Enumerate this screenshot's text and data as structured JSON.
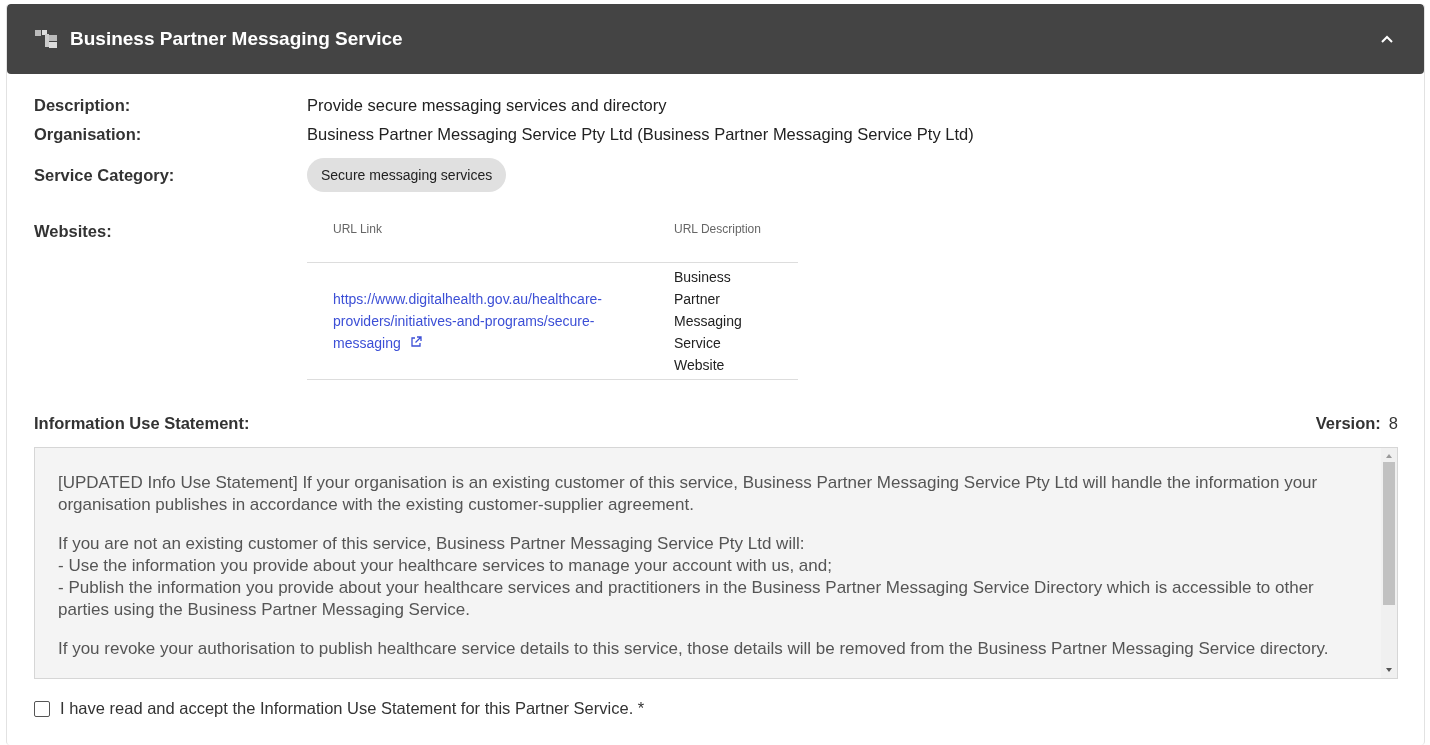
{
  "header": {
    "title": "Business Partner Messaging Service",
    "expanded": true
  },
  "fields": [
    {
      "label": "Description:",
      "value": "Provide secure messaging services and directory"
    },
    {
      "label": "Organisation:",
      "value": "Business Partner Messaging Service Pty Ltd (Business Partner Messaging Service Pty Ltd)"
    }
  ],
  "service_category": {
    "label": "Service Category:",
    "chip": "Secure messaging services"
  },
  "websites": {
    "label": "Websites:",
    "columns": [
      "URL Link",
      "URL Description"
    ],
    "rows": [
      {
        "url": "https://www.digitalhealth.gov.au/healthcare-providers/initiatives-and-programs/secure-messaging",
        "description": "Business Partner Messaging Service Website"
      }
    ]
  },
  "statement": {
    "label": "Information Use Statement:",
    "version_label": "Version:",
    "version": "8",
    "paragraphs": [
      [
        "[UPDATED Info Use Statement] If your organisation is an existing customer of this service, Business Partner Messaging Service Pty Ltd will handle the information your organisation publishes in accordance with the existing customer-supplier agreement."
      ],
      [
        "If you are not an existing customer of this service, Business Partner Messaging Service Pty Ltd will:",
        "- Use the information you provide about your healthcare services to manage your account with us, and;",
        "- Publish the information you provide about your healthcare services and practitioners in the Business Partner Messaging Service Directory which is accessible to other parties using the Business Partner Messaging Service."
      ],
      [
        "If you revoke your authorisation to publish healthcare service details to this service, those details will be removed from the Business Partner Messaging Service directory."
      ]
    ]
  },
  "accept": {
    "label": "I have read and accept the Information Use Statement for this Partner Service. *",
    "checked": false
  }
}
